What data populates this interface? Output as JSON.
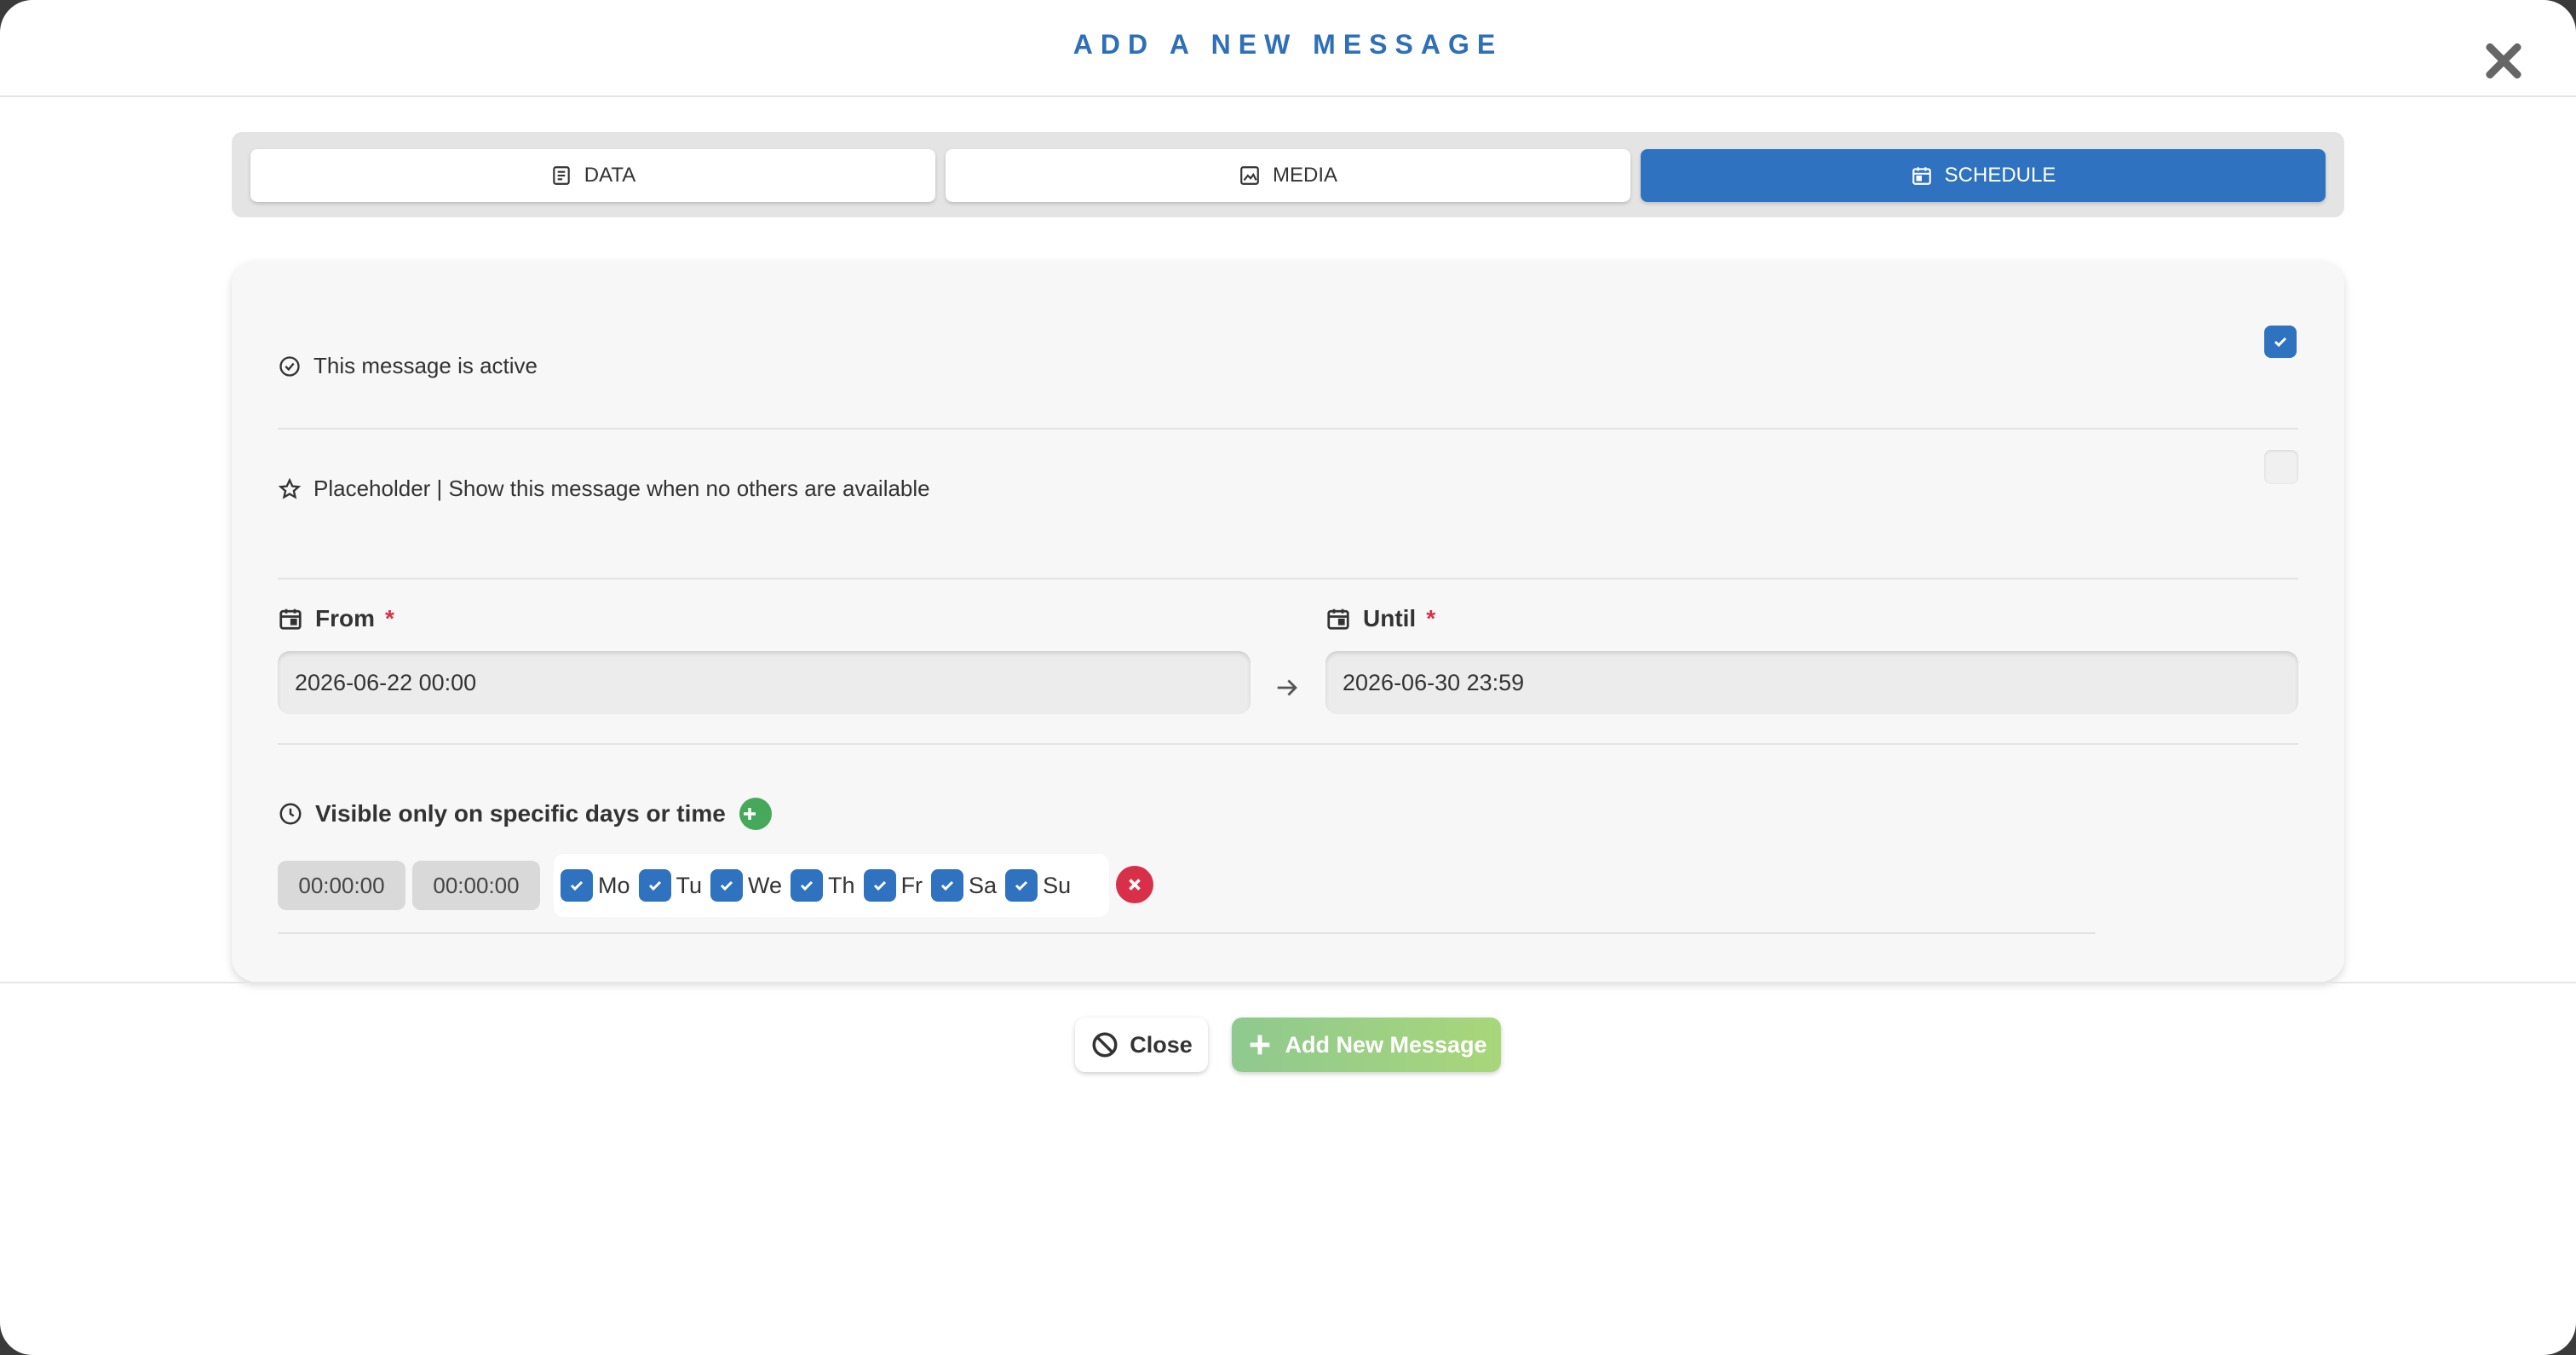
{
  "modal": {
    "title": "ADD A NEW MESSAGE",
    "close_icon": "close-icon"
  },
  "tabs": [
    {
      "label": "DATA",
      "icon": "document-icon",
      "active": false
    },
    {
      "label": "MEDIA",
      "icon": "image-icon",
      "active": false
    },
    {
      "label": "SCHEDULE",
      "icon": "calendar-icon",
      "active": true
    }
  ],
  "schedule": {
    "active_label": "This message is active",
    "active_checked": true,
    "placeholder_label": "Placeholder | Show this message when no others are available",
    "placeholder_checked": false,
    "from_label": "From",
    "from_value": "2026-06-22 00:00",
    "until_label": "Until",
    "until_value": "2026-06-30 23:59",
    "required_mark": "*",
    "visibility_label": "Visible only on specific days or time",
    "time_start": "00:00:00",
    "time_end": "00:00:00",
    "days": [
      "Mo",
      "Tu",
      "We",
      "Th",
      "Fr",
      "Sa",
      "Su"
    ]
  },
  "footer": {
    "close_label": "Close",
    "add_label": "Add New Message"
  },
  "colors": {
    "accent": "#2e72c0",
    "title": "#2e6fb8",
    "danger": "#d9304a",
    "success": "#46a85a"
  }
}
